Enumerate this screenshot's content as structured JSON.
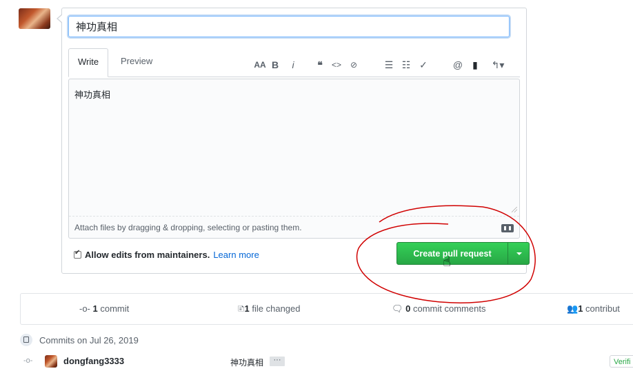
{
  "form": {
    "title_value": "神功真相",
    "tabs": {
      "write": "Write",
      "preview": "Preview"
    },
    "toolbar": [
      {
        "icon": "text-size-icon",
        "glyph": "AA"
      },
      {
        "icon": "bold-icon",
        "glyph": "B"
      },
      {
        "icon": "italic-icon",
        "glyph": "i"
      },
      {
        "icon": "quote-icon",
        "glyph": "❝"
      },
      {
        "icon": "code-icon",
        "glyph": "<>"
      },
      {
        "icon": "link-icon",
        "glyph": "⊘"
      },
      {
        "icon": "unordered-list-icon",
        "glyph": "☰"
      },
      {
        "icon": "ordered-list-icon",
        "glyph": "☷"
      },
      {
        "icon": "task-list-icon",
        "glyph": "✓"
      },
      {
        "icon": "mention-icon",
        "glyph": "@"
      },
      {
        "icon": "bookmark-icon",
        "glyph": "▮"
      },
      {
        "icon": "reply-icon",
        "glyph": "↰▾"
      }
    ],
    "body_value": "神功真相",
    "attach_hint": "Attach files by dragging & dropping, selecting or pasting them.",
    "allow_edits_label": "Allow edits from maintainers.",
    "learn_more": "Learn more",
    "create_button": "Create pull request"
  },
  "summary": {
    "commits_count": "1",
    "commits_label": "commit",
    "files_count": "1",
    "files_label": "file changed",
    "comments_count": "0",
    "comments_label": "commit comments",
    "contributors_count": "1",
    "contributors_label": "contribut"
  },
  "commits": {
    "heading": "Commits on Jul 26, 2019",
    "rows": [
      {
        "author": "dongfang3333",
        "message": "神功真相",
        "ellipsis": "···",
        "badge": "Verifi"
      }
    ]
  },
  "colors": {
    "primary_button": "#28a745",
    "link": "#0366d6",
    "annotation": "#d00000"
  }
}
